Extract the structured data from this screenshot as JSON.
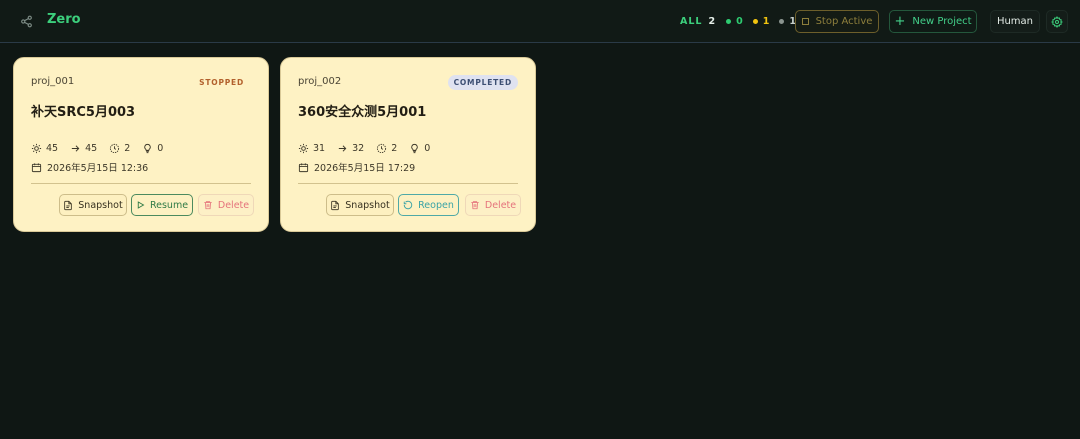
{
  "header": {
    "brand": "Zero",
    "counts": {
      "all_label": "ALL",
      "all": "2",
      "green": "0",
      "yellow": "1",
      "gray": "1",
      "green_color": "#2ecc71",
      "yellow_color": "#f1c40f",
      "gray_color": "#8a948f"
    },
    "stop_active_label": "Stop Active",
    "new_project_label": "New Project",
    "human_label": "Human"
  },
  "projects": [
    {
      "id": "proj_001",
      "status": "STOPPED",
      "title": "补天SRC5月003",
      "stats": {
        "nodes": "45",
        "links": "45",
        "pending": "2",
        "ideas": "0"
      },
      "date": "2026年5月15日 12:36",
      "actions": {
        "snapshot": "Snapshot",
        "primary": "Resume",
        "delete": "Delete"
      }
    },
    {
      "id": "proj_002",
      "status": "COMPLETED",
      "title": "360安全众测5月001",
      "stats": {
        "nodes": "31",
        "links": "32",
        "pending": "2",
        "ideas": "0"
      },
      "date": "2026年5月15日 17:29",
      "actions": {
        "snapshot": "Snapshot",
        "primary": "Reopen",
        "delete": "Delete"
      }
    }
  ]
}
